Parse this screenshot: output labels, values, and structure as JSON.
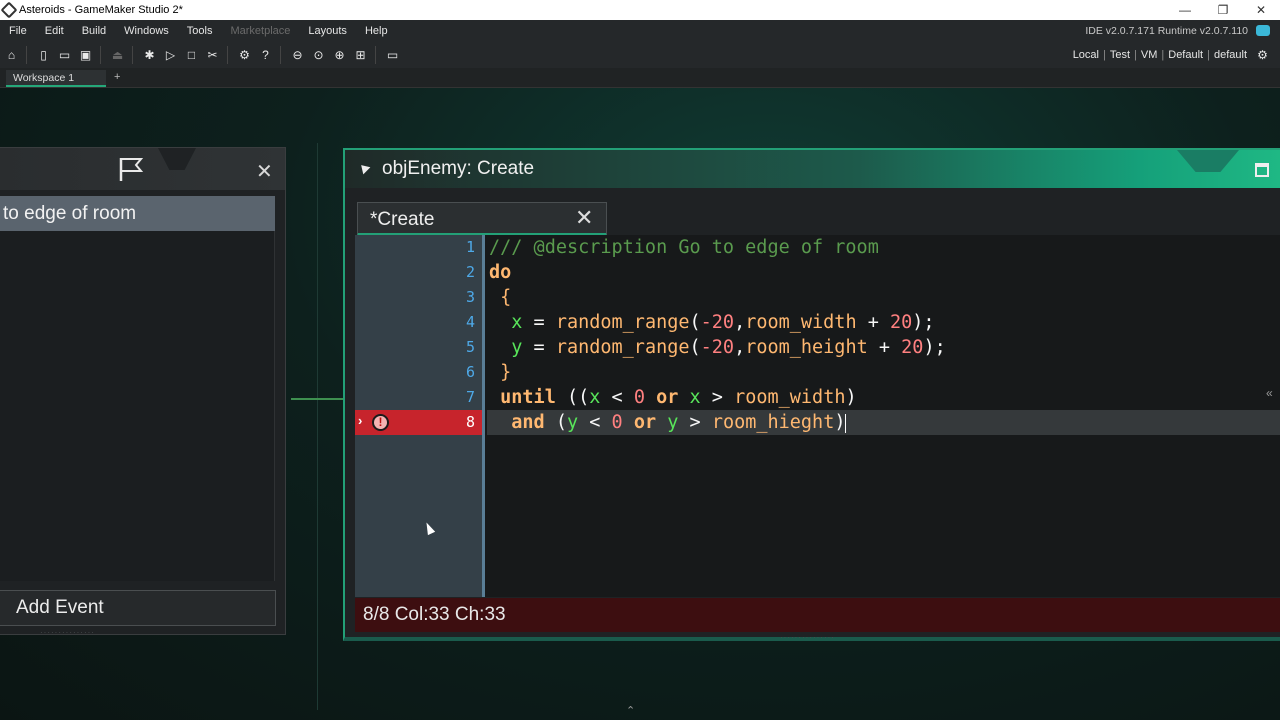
{
  "window": {
    "title": "Asteroids - GameMaker Studio 2*",
    "minimize": "—",
    "restore": "❐",
    "close": "✕"
  },
  "menu": {
    "items": [
      {
        "label": "File"
      },
      {
        "label": "Edit"
      },
      {
        "label": "Build"
      },
      {
        "label": "Windows"
      },
      {
        "label": "Tools"
      },
      {
        "label": "Marketplace"
      },
      {
        "label": "Layouts"
      },
      {
        "label": "Help"
      }
    ],
    "version": "IDE v2.0.7.171 Runtime v2.0.7.110"
  },
  "targets": {
    "platform": "Local",
    "device": "Test",
    "vm": "VM",
    "config": "Default",
    "profile": "default"
  },
  "workspace": {
    "tab_label": "Workspace 1",
    "add_label": "+"
  },
  "event_panel": {
    "selected_event": "to edge of room",
    "add_event_label": "Add Event",
    "close_label": "✕"
  },
  "editor": {
    "window_title": "objEnemy: Create",
    "tab_label": "*Create",
    "tab_close": "✕",
    "status": "8/8 Col:33 Ch:33",
    "error_line": 8,
    "line_numbers": [
      "1",
      "2",
      "3",
      "4",
      "5",
      "6",
      "7",
      "8"
    ],
    "code_lines": [
      "/// @description Go to edge of room",
      "do",
      " {",
      "  x = random_range(-20,room_width + 20);",
      "  y = random_range(-20,room_height + 20);",
      " }",
      " until ((x < 0 or x > room_width)",
      "  and (y < 0 or y > room_hieght)"
    ]
  },
  "colors": {
    "accent": "#23a077",
    "error": "#c7242c",
    "comment": "#5a9b4e",
    "keyword": "#ffb871",
    "variable": "#58e55a",
    "number": "#ff8080",
    "line_number": "#4ea9e8"
  }
}
